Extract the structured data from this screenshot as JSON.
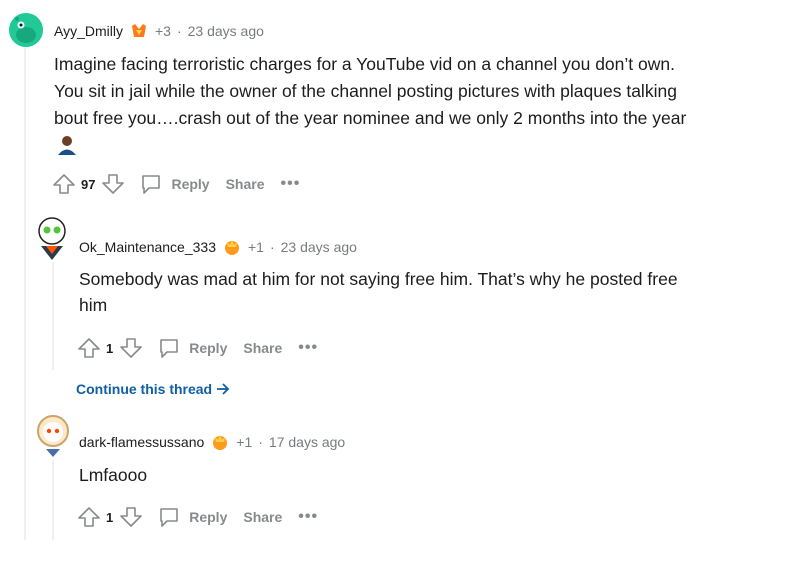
{
  "comments": [
    {
      "username": "Ayy_Dmilly",
      "score_delta": "+3",
      "separator": "·",
      "time": "23 days ago",
      "body_lines": [
        "Imagine facing terroristic charges for a YouTube vid on a channel you don’t own.",
        "You sit in jail while the owner of the channel posting pictures with plaques talking",
        "bout free you….crash out of the year nominee and we only 2 months into the year"
      ],
      "votes": "97",
      "reply_label": "Reply",
      "share_label": "Share",
      "more_label": "•••"
    },
    {
      "username": "Ok_Maintenance_333",
      "score_delta": "+1",
      "separator": "·",
      "time": "23 days ago",
      "body_lines": [
        "Somebody was mad at him for not saying free him. That’s why he posted free",
        "him"
      ],
      "votes": "1",
      "reply_label": "Reply",
      "share_label": "Share",
      "more_label": "•••"
    },
    {
      "username": "dark-flamessussano",
      "score_delta": "+1",
      "separator": "·",
      "time": "17 days ago",
      "body_lines": [
        "Lmfaooo"
      ],
      "votes": "1",
      "reply_label": "Reply",
      "share_label": "Share",
      "more_label": "•••"
    }
  ],
  "continue_thread": "Continue this thread",
  "colors": {
    "link": "#0f5ea6",
    "muted": "#878a8c",
    "text": "#1c1c1c",
    "thread_line": "#edeff1"
  }
}
